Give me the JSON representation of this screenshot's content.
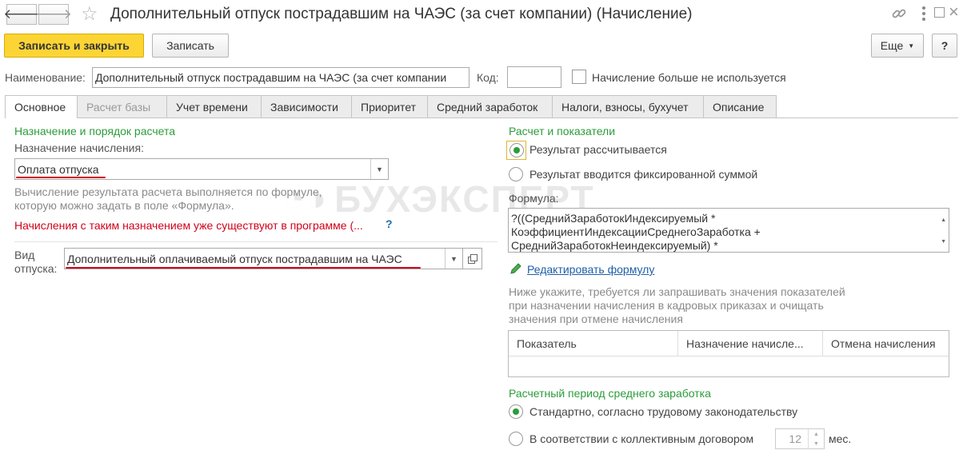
{
  "header": {
    "back_icon": "arrow-left-icon",
    "forward_icon": "arrow-right-icon",
    "star_icon": "star-icon",
    "title": "Дополнительный отпуск пострадавшим на ЧАЭС (за счет компании) (Начисление)",
    "link_icon": "link-icon",
    "menu_icon": "more-vertical-icon",
    "maximize_icon": "maximize-icon",
    "close_icon": "close-icon"
  },
  "toolbar": {
    "save_close_label": "Записать и закрыть",
    "save_label": "Записать",
    "more_label": "Еще",
    "help_label": "?"
  },
  "form": {
    "name_label": "Наименование:",
    "name_value": "Дополнительный отпуск пострадавшим на ЧАЭС (за счет компании",
    "code_label": "Код:",
    "code_value": "",
    "unused_label": "Начисление больше не используется"
  },
  "tabs": [
    {
      "label": "Основное"
    },
    {
      "label": "Расчет базы"
    },
    {
      "label": "Учет времени"
    },
    {
      "label": "Зависимости"
    },
    {
      "label": "Приоритет"
    },
    {
      "label": "Средний заработок"
    },
    {
      "label": "Налоги, взносы, бухучет"
    },
    {
      "label": "Описание"
    }
  ],
  "left": {
    "section_title": "Назначение и порядок расчета",
    "purpose_label": "Назначение начисления:",
    "purpose_value": "Оплата отпуска",
    "hint_line1": "Вычисление результата расчета выполняется по формуле,",
    "hint_line2": "которую можно задать в поле «Формула».",
    "warning": "Начисления с таким назначением уже существуют в программе (...",
    "warning_q": "?",
    "leave_label_1": "Вид",
    "leave_label_2": "отпуска:",
    "leave_value": "Дополнительный оплачиваемый отпуск пострадавшим на ЧАЭС"
  },
  "watermark": "БУХЭКСПЕРТ",
  "right": {
    "section_title": "Расчет и показатели",
    "radio_calc": "Результат рассчитывается",
    "radio_fixed": "Результат вводится фиксированной суммой",
    "formula_label": "Формула:",
    "formula_lines": [
      "?((СреднийЗаработокИндексируемый *",
      "КоэффициентИндексацииСреднегоЗаработка +",
      "СреднийЗаработокНеиндексируемый) *"
    ],
    "edit_formula": "Редактировать формулу",
    "edit_icon": "pencil-icon",
    "indicators_hint_1": "Ниже укажите, требуется ли запрашивать значения показателей",
    "indicators_hint_2": "при назначении начисления в кадровых приказах и очищать",
    "indicators_hint_3": "значения при отмене начисления",
    "table_headers": [
      "Показатель",
      "Назначение начисле...",
      "Отмена начисления"
    ],
    "avg_title": "Расчетный период среднего заработка",
    "radio_standard": "Стандартно, согласно трудовому законодательству",
    "radio_collective": "В соответствии с коллективным договором",
    "months_value": "12",
    "months_unit": "мес."
  }
}
